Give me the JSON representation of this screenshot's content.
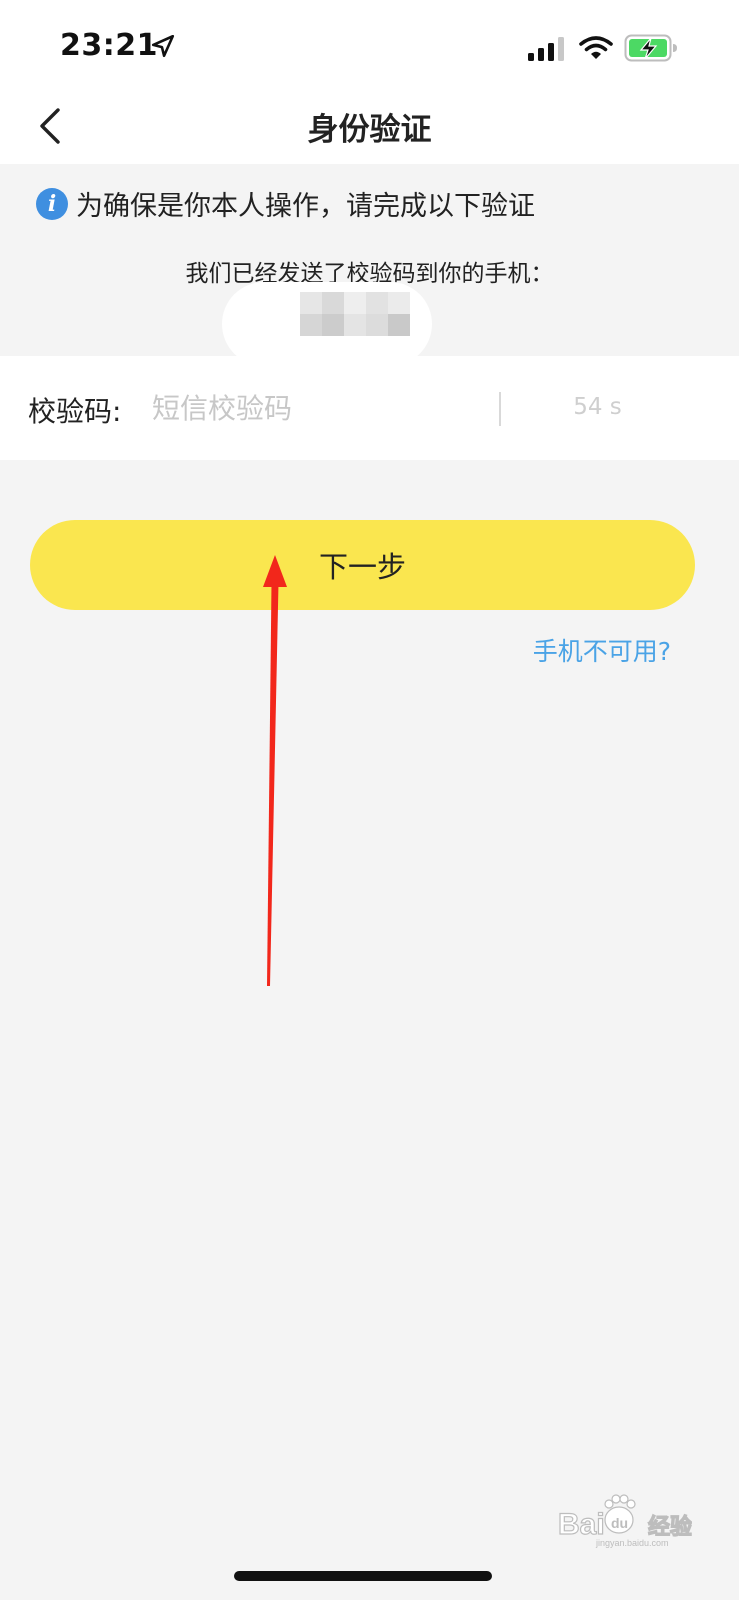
{
  "status_bar": {
    "time": "23:21",
    "location_icon": "location-arrow-icon",
    "signal_icon": "cellular-signal-icon",
    "wifi_icon": "wifi-icon",
    "battery_icon": "battery-charging-icon",
    "battery_color": "#4cd964"
  },
  "nav": {
    "back_icon": "chevron-left-icon",
    "title": "身份验证"
  },
  "info": {
    "notice_icon": "info-icon",
    "notice_glyph": "i",
    "notice_text": "为确保是你本人操作，请完成以下验证",
    "sent_text": "我们已经发送了校验码到你的手机："
  },
  "code_field": {
    "label": "校验码:",
    "placeholder": "短信校验码",
    "value": "",
    "countdown": "54 s"
  },
  "actions": {
    "next_label": "下一步",
    "next_color": "#fae64f",
    "phone_unavailable_label": "手机不可用?",
    "link_color": "#4aa3e6"
  },
  "annotation": {
    "arrow_color": "#f2271b"
  },
  "watermark": {
    "text": "Baidu经验",
    "subtext": "jingyan.baidu.com"
  }
}
